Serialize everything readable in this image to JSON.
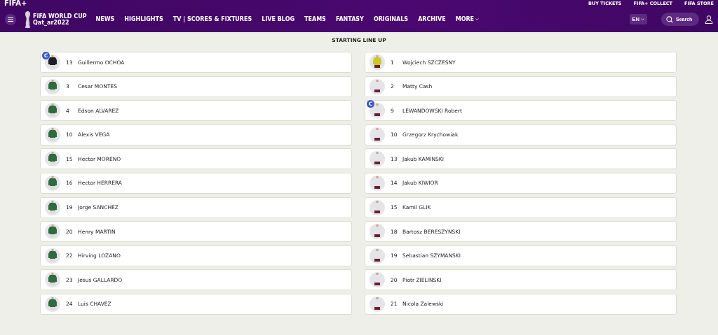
{
  "header": {
    "logo": "FIFA+",
    "top_links": [
      "BUY TICKETS",
      "FIFA+ COLLECT",
      "FIFA STORE"
    ],
    "brand": {
      "line_1": "FIFA WORLD CUP",
      "line_2": "Qat_ar2022"
    },
    "nav": [
      "NEWS",
      "HIGHLIGHTS",
      "TV | SCORES & FIXTURES",
      "LIVE BLOG",
      "TEAMS",
      "FANTASY",
      "ORIGINALS",
      "ARCHIVE",
      "MORE"
    ],
    "language": "EN",
    "search": "Search"
  },
  "section_title": "STARTING LINE UP",
  "teams": [
    {
      "players": [
        {
          "number": "13",
          "name": "Guillermo OCHOA",
          "color": "#1c1c24",
          "badge": "C"
        },
        {
          "number": "3",
          "name": "Cesar MONTES",
          "color": "#2f6b3e"
        },
        {
          "number": "4",
          "name": "Edson ALVAREZ",
          "color": "#2f6b3e"
        },
        {
          "number": "10",
          "name": "Alexis VEGA",
          "color": "#2f6b3e"
        },
        {
          "number": "15",
          "name": "Hector MORENO",
          "color": "#2f6b3e"
        },
        {
          "number": "16",
          "name": "Hector HERRERA",
          "color": "#2f6b3e"
        },
        {
          "number": "19",
          "name": "Jorge SANCHEZ",
          "color": "#2f6b3e"
        },
        {
          "number": "20",
          "name": "Henry MARTIN",
          "color": "#2f6b3e"
        },
        {
          "number": "22",
          "name": "Hirving LOZANO",
          "color": "#2f6b3e"
        },
        {
          "number": "23",
          "name": "Jesus GALLARDO",
          "color": "#2f6b3e"
        },
        {
          "number": "24",
          "name": "Luis CHAVEZ",
          "color": "#2f6b3e"
        }
      ]
    },
    {
      "players": [
        {
          "number": "1",
          "name": "Wojciech SZCZESNY",
          "color": "#c9c92a"
        },
        {
          "number": "2",
          "name": "Matty Cash",
          "color": "#e4e4ea"
        },
        {
          "number": "9",
          "name": "LEWANDOWSKI Robert",
          "color": "#e4e4ea",
          "badge": "C"
        },
        {
          "number": "10",
          "name": "Grzegorz Krychowiak",
          "color": "#e4e4ea"
        },
        {
          "number": "13",
          "name": "Jakub KAMINSKI",
          "color": "#e4e4ea"
        },
        {
          "number": "14",
          "name": "Jakub KIWIOR",
          "color": "#e4e4ea"
        },
        {
          "number": "15",
          "name": "Kamil GLIK",
          "color": "#e4e4ea"
        },
        {
          "number": "18",
          "name": "Bartosz BERESZYNSKI",
          "color": "#e4e4ea"
        },
        {
          "number": "19",
          "name": "Sebastian SZYMANSKI",
          "color": "#e4e4ea"
        },
        {
          "number": "20",
          "name": "Piotr ZIELINSKI",
          "color": "#e4e4ea"
        },
        {
          "number": "21",
          "name": "Nicola Zalewski",
          "color": "#e4e4ea"
        }
      ]
    }
  ]
}
